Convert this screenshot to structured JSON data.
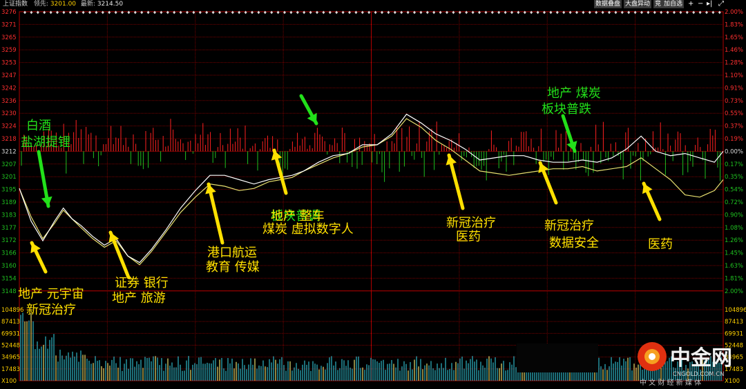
{
  "header": {
    "index_name": "上证指数",
    "lead_label": "领先:",
    "lead_value": "3201.00",
    "last_label": "最新:",
    "last_value": "3214.50",
    "buttons": [
      "数据叠盘",
      "大盘异动",
      "竞",
      "加自选"
    ],
    "icons": [
      "plus-icon",
      "minus-icon",
      "step-right-icon",
      "expand-icon"
    ]
  },
  "chart_data": {
    "type": "line",
    "title": "上证指数",
    "prev_close": 3212,
    "y_price_ticks": [
      3276,
      3271,
      3265,
      3259,
      3253,
      3247,
      3242,
      3236,
      3230,
      3224,
      3218,
      3212,
      3207,
      3201,
      3195,
      3189,
      3183,
      3177,
      3172,
      3166,
      3160,
      3154,
      3148
    ],
    "y_pct_ticks": [
      "2.00%",
      "1.83%",
      "1.65%",
      "1.46%",
      "1.28%",
      "1.10%",
      "0.91%",
      "0.73%",
      "0.55%",
      "0.37%",
      "0.19%",
      "0.00%",
      "0.17%",
      "0.35%",
      "0.54%",
      "0.72%",
      "0.90%",
      "1.08%",
      "1.26%",
      "1.45%",
      "1.63%",
      "1.81%",
      "2.00%"
    ],
    "volume_ticks_left": [
      "104896",
      "87413",
      "69931",
      "52448",
      "34965",
      "17483",
      "X100"
    ],
    "volume_ticks_right": [
      "104896",
      "87413",
      "69931",
      "52448",
      "34965",
      "17483",
      "X100"
    ],
    "series": [
      {
        "name": "",
        "color": "#ffffff",
        "x": [
          0,
          4,
          8,
          12,
          15,
          18,
          21,
          25,
          29,
          33,
          37,
          41,
          45,
          50,
          55,
          60,
          65,
          70,
          75,
          80,
          85,
          89,
          93,
          97,
          102,
          107,
          112,
          117,
          122,
          127,
          132,
          137,
          142,
          147,
          152,
          157,
          162,
          167,
          172,
          177,
          182,
          187,
          192,
          197,
          202,
          207,
          212,
          217,
          222,
          227,
          232,
          237,
          240
        ],
        "y": [
          3195,
          3180,
          3171,
          3180,
          3186,
          3181,
          3178,
          3173,
          3169,
          3172,
          3164,
          3161,
          3167,
          3176,
          3186,
          3194,
          3201,
          3201,
          3199,
          3197,
          3199,
          3200,
          3201,
          3203,
          3207,
          3210,
          3211,
          3215,
          3215,
          3220,
          3229,
          3225,
          3220,
          3217,
          3213,
          3208,
          3209,
          3210,
          3210,
          3208,
          3207,
          3207,
          3208,
          3207,
          3209,
          3213,
          3219,
          3212,
          3210,
          3211,
          3209,
          3207,
          3212
        ]
      },
      {
        "name": "",
        "color": "#e8e070",
        "x": [
          0,
          4,
          8,
          12,
          15,
          18,
          21,
          25,
          29,
          33,
          37,
          41,
          45,
          50,
          55,
          60,
          65,
          70,
          75,
          80,
          85,
          89,
          93,
          97,
          102,
          107,
          112,
          117,
          122,
          127,
          132,
          137,
          142,
          147,
          152,
          157,
          162,
          167,
          172,
          177,
          182,
          187,
          192,
          197,
          202,
          207,
          212,
          217,
          222,
          227,
          232,
          237,
          240
        ],
        "y": [
          3195,
          3182,
          3172,
          3179,
          3185,
          3181,
          3177,
          3172,
          3168,
          3171,
          3164,
          3160,
          3166,
          3175,
          3184,
          3191,
          3197,
          3196,
          3194,
          3195,
          3198,
          3199,
          3200,
          3203,
          3206,
          3209,
          3211,
          3214,
          3215,
          3219,
          3227,
          3223,
          3217,
          3213,
          3208,
          3203,
          3202,
          3201,
          3202,
          3203,
          3204,
          3204,
          3205,
          3203,
          3204,
          3205,
          3209,
          3204,
          3199,
          3192,
          3191,
          3194,
          3199
        ]
      }
    ],
    "annotations": [
      {
        "text": "白酒",
        "color": "#22e01a"
      },
      {
        "text": "盐湖提锂",
        "color": "#22e01a"
      },
      {
        "text": "地产 元宇宙",
        "color": "#ffe000"
      },
      {
        "text": "新冠治疗",
        "color": "#ffe000"
      },
      {
        "text": "证券 银行",
        "color": "#ffe000"
      },
      {
        "text": "地产 旅游",
        "color": "#ffe000"
      },
      {
        "text": "港口航运",
        "color": "#ffe000"
      },
      {
        "text": "教育 传媒",
        "color": "#ffe000"
      },
      {
        "text": "板块普调",
        "color": "#22e01a"
      },
      {
        "text": "地产 整车",
        "color": "#ffe000"
      },
      {
        "text": "煤炭 虚拟数字人",
        "color": "#ffe000"
      },
      {
        "text": "新冠治疗",
        "color": "#ffe000"
      },
      {
        "text": "医药",
        "color": "#ffe000"
      },
      {
        "text": "地产 煤炭",
        "color": "#22e01a"
      },
      {
        "text": "板块普跌",
        "color": "#22e01a"
      },
      {
        "text": "新冠治疗",
        "color": "#ffe000"
      },
      {
        "text": "数据安全",
        "color": "#ffe000"
      },
      {
        "text": "医药",
        "color": "#ffe000"
      }
    ],
    "grid": true,
    "colors": {
      "up": "#ff2020",
      "down": "#20c020",
      "grid": "#7a0000",
      "price_line": "#ffffff",
      "avg_line": "#e8e070",
      "volume": "#2fb8c8"
    }
  },
  "watermark": {
    "brand": "中金网",
    "domain": "CNGOLD.COM.CN",
    "tagline": "中 文 财 经 新 媒 体"
  }
}
